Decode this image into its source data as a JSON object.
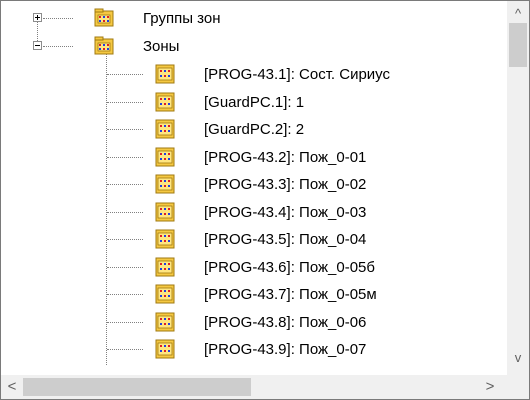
{
  "tree": {
    "groups_node": {
      "label": "Группы зон",
      "icon": "zone-group-icon",
      "expanded": false
    },
    "zones_node": {
      "label": "Зоны",
      "icon": "zone-group-icon",
      "expanded": true
    },
    "zones": [
      {
        "label": "[PROG-43.1]: Сост. Сириус",
        "icon": "zone-icon"
      },
      {
        "label": "[GuardPC.1]: 1",
        "icon": "zone-icon"
      },
      {
        "label": "[GuardPC.2]: 2",
        "icon": "zone-icon"
      },
      {
        "label": "[PROG-43.2]: Пож_0-01",
        "icon": "zone-icon"
      },
      {
        "label": "[PROG-43.3]: Пож_0-02",
        "icon": "zone-icon"
      },
      {
        "label": "[PROG-43.4]: Пож_0-03",
        "icon": "zone-icon"
      },
      {
        "label": "[PROG-43.5]: Пож_0-04",
        "icon": "zone-icon"
      },
      {
        "label": "[PROG-43.6]: Пож_0-05б",
        "icon": "zone-icon"
      },
      {
        "label": "[PROG-43.7]: Пож_0-05м",
        "icon": "zone-icon"
      },
      {
        "label": "[PROG-43.8]: Пож_0-06",
        "icon": "zone-icon"
      },
      {
        "label": "[PROG-43.9]: Пож_0-07",
        "icon": "zone-icon"
      }
    ]
  },
  "scrollbars": {
    "up_arrow": "^",
    "down_arrow": "v",
    "left_arrow": "<",
    "right_arrow": ">"
  },
  "colors": {
    "folder_body": "#f5c842",
    "folder_border": "#a07a10",
    "grid_red": "#e02020",
    "grid_blue": "#2040e0",
    "scrollbar_track": "#f0f0f0",
    "scrollbar_thumb": "#cdcdcd"
  }
}
